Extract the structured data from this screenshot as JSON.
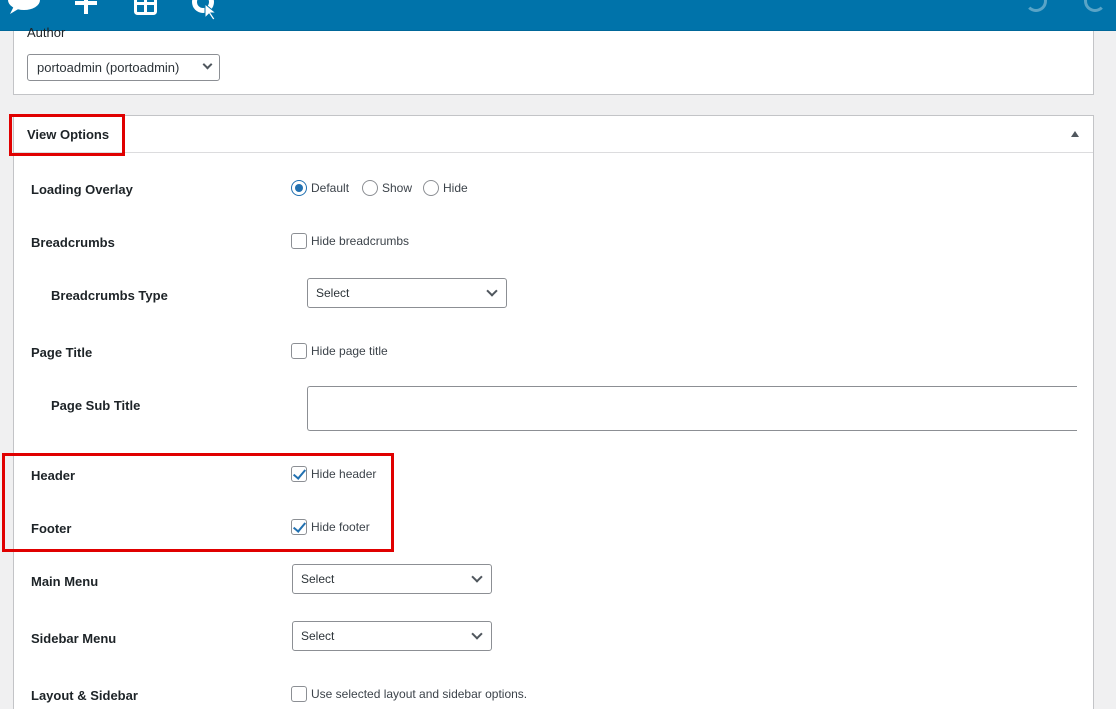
{
  "toolbar": {
    "icons": [
      "wordpress-logo-icon",
      "add-block-icon",
      "layout-icon",
      "assistant-icon",
      "undo-icon",
      "redo-icon"
    ]
  },
  "author": {
    "label": "Author",
    "selected": "portoadmin (portoadmin)"
  },
  "view_options": {
    "title": "View Options",
    "loading_overlay": {
      "label": "Loading Overlay",
      "options": [
        "Default",
        "Show",
        "Hide"
      ],
      "selected": "Default"
    },
    "breadcrumbs": {
      "label": "Breadcrumbs",
      "checkbox_label": "Hide breadcrumbs",
      "checked": false
    },
    "breadcrumbs_type": {
      "label": "Breadcrumbs Type",
      "value": "Select"
    },
    "page_title": {
      "label": "Page Title",
      "checkbox_label": "Hide page title",
      "checked": false
    },
    "page_sub_title": {
      "label": "Page Sub Title",
      "value": ""
    },
    "header": {
      "label": "Header",
      "checkbox_label": "Hide header",
      "checked": true
    },
    "footer": {
      "label": "Footer",
      "checkbox_label": "Hide footer",
      "checked": true
    },
    "main_menu": {
      "label": "Main Menu",
      "value": "Select"
    },
    "sidebar_menu": {
      "label": "Sidebar Menu",
      "value": "Select"
    },
    "layout_sidebar": {
      "label": "Layout & Sidebar",
      "checkbox_label": "Use selected layout and sidebar options.",
      "checked": false
    }
  },
  "colors": {
    "toolbar_bg": "#0073aa",
    "accent": "#2271b1",
    "highlight": "#e00000"
  }
}
